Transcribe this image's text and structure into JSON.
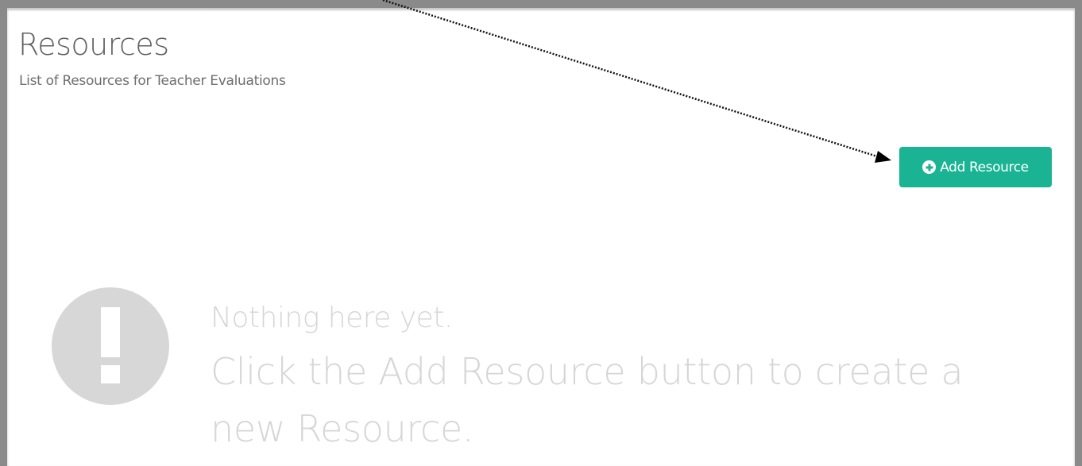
{
  "page": {
    "title": "Resources",
    "subtitle": "List of Resources for Teacher Evaluations"
  },
  "toolbar": {
    "add_label": "Add Resource",
    "add_icon": "plus-circle-icon",
    "accent_color": "#1ab394"
  },
  "empty_state": {
    "icon": "exclamation-circle-icon",
    "heading": "Nothing here yet.",
    "message": "Click the Add Resource button to create a new Resource."
  },
  "annotation": {
    "icon": "dotted-arrow"
  }
}
